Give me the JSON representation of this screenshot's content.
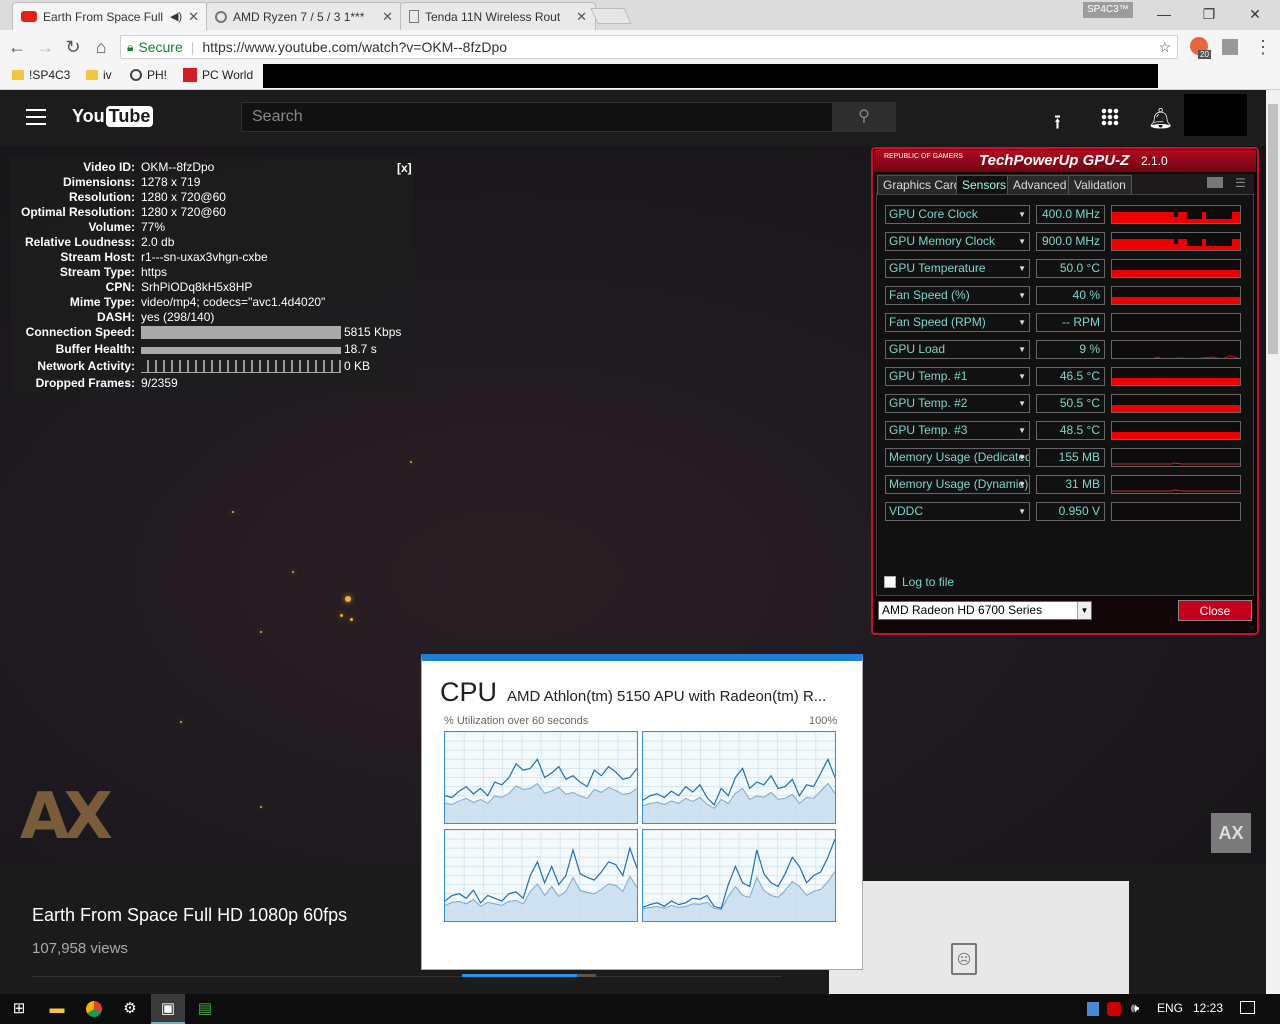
{
  "browser": {
    "tabs": [
      {
        "label": "Earth From Space Full",
        "active": true,
        "icon": "youtube-icon"
      },
      {
        "label": "AMD Ryzen 7 / 5 / 3 1***",
        "active": false,
        "icon": "loading-icon"
      },
      {
        "label": "Tenda 11N Wireless Rout",
        "active": false,
        "icon": "document-icon"
      }
    ],
    "profile": "SP4C3™",
    "secure_label": "Secure",
    "url": "https://www.youtube.com/watch?v=OKM--8fzDpo",
    "extension_badge": "20",
    "bookmarks": [
      "!SP4C3",
      "iv",
      "PH!",
      "PC World"
    ]
  },
  "youtube": {
    "search_placeholder": "Search",
    "video_title": "Earth From Space Full HD 1080p 60fps",
    "views": "107,958 views"
  },
  "stats": {
    "close_label": "[x]",
    "rows": [
      {
        "k": "Video ID:",
        "v": "OKM--8fzDpo"
      },
      {
        "k": "Dimensions:",
        "v": "1278 x 719"
      },
      {
        "k": "Resolution:",
        "v": "1280 x 720@60"
      },
      {
        "k": "Optimal Resolution:",
        "v": "1280 x 720@60"
      },
      {
        "k": "Volume:",
        "v": "77%"
      },
      {
        "k": "Relative Loudness:",
        "v": "2.0 db"
      },
      {
        "k": "Stream Host:",
        "v": "r1---sn-uxax3vhgn-cxbe"
      },
      {
        "k": "Stream Type:",
        "v": "https"
      },
      {
        "k": "CPN:",
        "v": "SrhPiODq8kH5x8HP"
      },
      {
        "k": "Mime Type:",
        "v": "video/mp4; codecs=\"avc1.4d4020\""
      },
      {
        "k": "DASH:",
        "v": "yes (298/140)"
      }
    ],
    "bars": [
      {
        "k": "Connection Speed:",
        "v": "5815 Kbps"
      },
      {
        "k": "Buffer Health:",
        "v": "18.7 s"
      },
      {
        "k": "Network Activity:",
        "v": "0 KB"
      }
    ],
    "dropped": {
      "k": "Dropped Frames:",
      "v": "9/2359"
    }
  },
  "watermark": {
    "text": "AX",
    "small": "AX"
  },
  "gpuz": {
    "title": "TechPowerUp GPU-Z",
    "version": "2.1.0",
    "brand": "REPUBLIC OF GAMERS",
    "tabs": [
      "Graphics Card",
      "Sensors",
      "Advanced",
      "Validation"
    ],
    "active_tab": "Sensors",
    "sensors": [
      {
        "name": "GPU Core Clock",
        "value": "400.0 MHz",
        "graph": "steps"
      },
      {
        "name": "GPU Memory Clock",
        "value": "900.0 MHz",
        "graph": "steps"
      },
      {
        "name": "GPU Temperature",
        "value": "50.0 °C",
        "graph": "flat"
      },
      {
        "name": "Fan Speed (%)",
        "value": "40 %",
        "graph": "flat"
      },
      {
        "name": "Fan Speed (RPM)",
        "value": "-- RPM",
        "graph": "none"
      },
      {
        "name": "GPU Load",
        "value": "9 %",
        "graph": "low"
      },
      {
        "name": "GPU Temp. #1",
        "value": "46.5 °C",
        "graph": "flat"
      },
      {
        "name": "GPU Temp. #2",
        "value": "50.5 °C",
        "graph": "flat"
      },
      {
        "name": "GPU Temp. #3",
        "value": "48.5 °C",
        "graph": "flat"
      },
      {
        "name": "Memory Usage (Dedicated)",
        "value": "155 MB",
        "graph": "line"
      },
      {
        "name": "Memory Usage (Dynamic)",
        "value": "31 MB",
        "graph": "line"
      },
      {
        "name": "VDDC",
        "value": "0.950 V",
        "graph": "none"
      }
    ],
    "log_label": "Log to file",
    "gpu_select": "AMD Radeon HD 6700 Series",
    "close_label": "Close"
  },
  "cpu": {
    "heading": "CPU",
    "name": "AMD Athlon(tm) 5150 APU with Radeon(tm) R...",
    "subtitle": "% Utilization over 60 seconds",
    "max_label": "100%"
  },
  "taskbar": {
    "lang": "ENG",
    "time": "12:23"
  },
  "colors": {
    "gpuz_red": "#c8102e",
    "gpuz_text": "#7bd6c9",
    "cpu_line": "#1f6fb5",
    "yt_header": "#1c1c1c"
  }
}
